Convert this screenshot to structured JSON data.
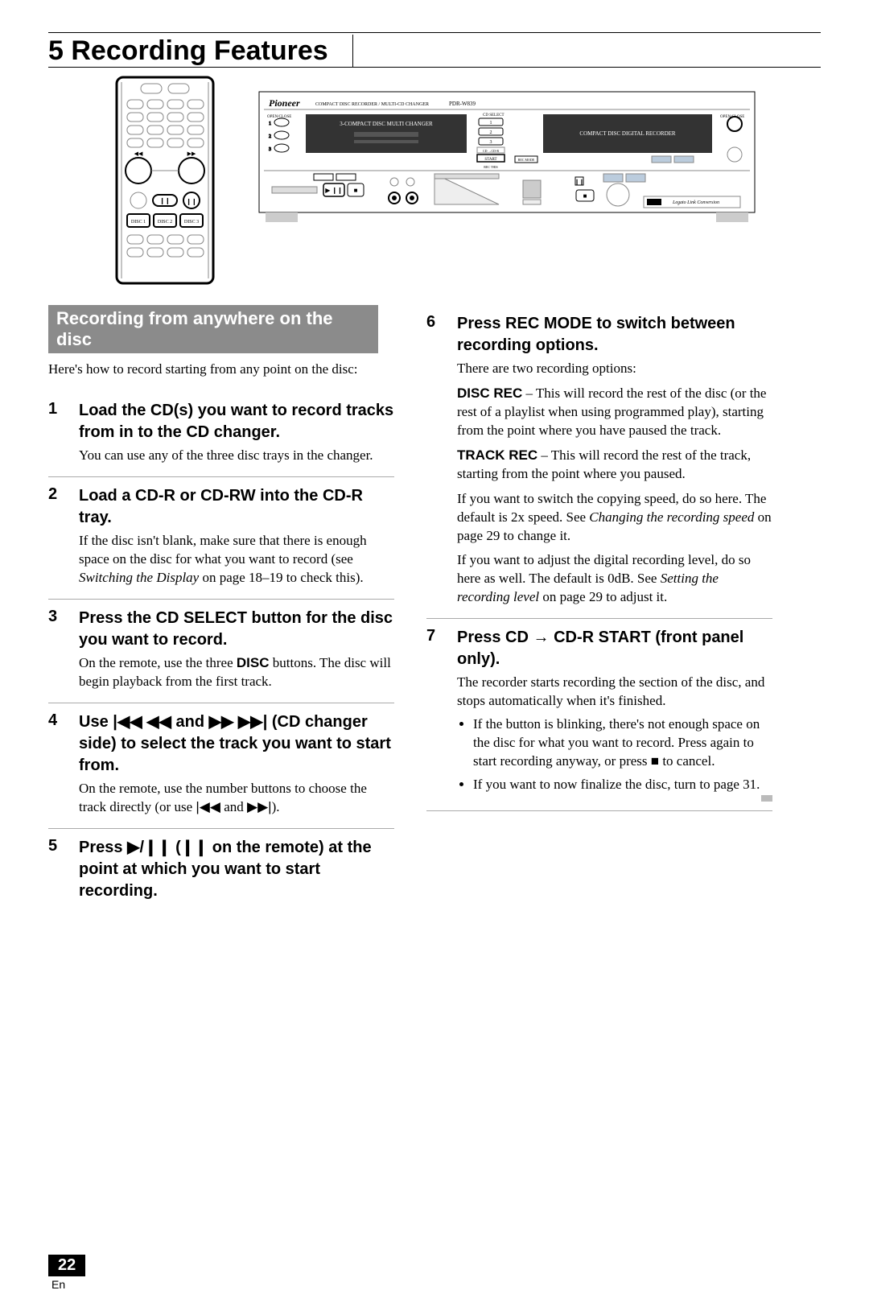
{
  "chapter": "5 Recording Features",
  "sectionHeading": "Recording from anywhere on the disc",
  "intro": "Here's how to record starting from any point on the disc:",
  "left": {
    "steps": [
      {
        "num": "1",
        "head": "Load the CD(s) you want to record tracks from in to the CD changer.",
        "text": "You can use any of the three disc trays in the changer."
      },
      {
        "num": "2",
        "head": "Load a CD-R or CD-RW into the CD-R tray.",
        "text_pre": "If the disc isn't blank, make sure that there is enough space on the disc for what you want to record (see ",
        "text_ital": "Switching the Display",
        "text_post": " on page 18–19 to check this)."
      },
      {
        "num": "3",
        "head": "Press the CD SELECT button for the disc you want to record.",
        "text_pre": "On the remote, use the three ",
        "text_bold": "DISC",
        "text_post": " buttons. The disc will begin playback from the first track."
      },
      {
        "num": "4",
        "head_pre": "Use ",
        "head_glyphs1": "|◀◀ ◀◀",
        "head_mid": " and ",
        "head_glyphs2": "▶▶ ▶▶|",
        "head_post": " (CD changer side) to select the track you want to start from.",
        "text_pre": "On the remote, use the number buttons to choose the track directly (or use ",
        "text_glyphs1": "|◀◀",
        "text_mid": " and ",
        "text_glyphs2": "▶▶|",
        "text_post": ")."
      },
      {
        "num": "5",
        "head_pre": "Press ",
        "head_glyph": "▶/❙❙",
        "head_mid": " (",
        "head_glyph2": "❙❙",
        "head_post": " on the remote) at the point at which you want to start recording."
      }
    ]
  },
  "right": {
    "steps": [
      {
        "num": "6",
        "head": "Press REC MODE to switch between recording options.",
        "lead": "There are two recording options:",
        "opt1_bold": "DISC REC",
        "opt1_rest": " – This will record the rest of the disc (or the rest of a playlist when using programmed play), starting from the point where you have paused the track.",
        "opt2_bold": "TRACK REC",
        "opt2_rest": " – This will record the rest of the track, starting from the point where you paused.",
        "para1_pre": "If you want to switch the copying speed, do so here. The default is 2x speed. See ",
        "para1_ital": "Changing the recording speed",
        "para1_post": " on page 29 to change it.",
        "para2_pre": "If you want to adjust the digital recording level, do so here as well. The default is 0dB. See ",
        "para2_ital": "Setting the recording level",
        "para2_post": " on page 29 to adjust it."
      },
      {
        "num": "7",
        "head_pre": "Press CD",
        "head_arrow": " → ",
        "head_post": "CD-R START (front panel only).",
        "lead": "The recorder starts recording the section of the disc, and stops automatically when it's finished.",
        "bullet1_pre": "If the button is blinking, there's not enough space on the disc for what you want to record. Press again to start recording anyway, or press ",
        "bullet1_glyph": "■",
        "bullet1_post": " to cancel.",
        "bullet2": "If you want to now finalize the disc, turn to page 31."
      }
    ]
  },
  "pageNumber": "22",
  "langCode": "En",
  "illust": {
    "brand": "Pioneer",
    "subtitle1": "COMPACT DISC RECORDER / MULTI-CD CHANGER",
    "model": "PDR-W839",
    "changerLabel": "3-COMPACT DISC MULTI CHANGER",
    "recorderLabel": "COMPACT DISC DIGITAL RECORDER",
    "openClose": "OPEN/CLOSE",
    "cdSelect": "CD SELECT",
    "start": "START",
    "cd_cdr": "CD →CD-R",
    "recMode": "REC MODE",
    "recThis": "REC THIS",
    "legato": "Legato Link Conversion",
    "disc1": "DISC 1",
    "disc2": "DISC 2",
    "disc3": "DISC 3"
  }
}
